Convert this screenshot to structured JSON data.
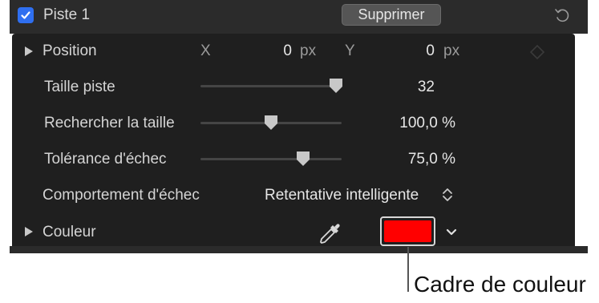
{
  "header": {
    "checked": true,
    "title": "Piste 1",
    "delete_label": "Supprimer"
  },
  "rows": {
    "position": {
      "label": "Position",
      "x_label": "X",
      "x_value": "0",
      "x_unit": "px",
      "y_label": "Y",
      "y_value": "0",
      "y_unit": "px"
    },
    "track_size": {
      "label": "Taille piste",
      "value": "32",
      "slider_fraction": 0.95
    },
    "search_size": {
      "label": "Rechercher la taille",
      "value": "100,0 %",
      "slider_fraction": 0.5
    },
    "fail_tolerance": {
      "label": "Tolérance d'échec",
      "value": "75,0 %",
      "slider_fraction": 0.73
    },
    "fail_behavior": {
      "label": "Comportement d'échec",
      "value": "Retentative intelligente"
    },
    "color": {
      "label": "Couleur",
      "swatch_color": "#ff0000"
    }
  },
  "callout": {
    "text": "Cadre de couleur"
  },
  "colors": {
    "accent": "#2f6ff0",
    "swatch": "#ff0000"
  }
}
